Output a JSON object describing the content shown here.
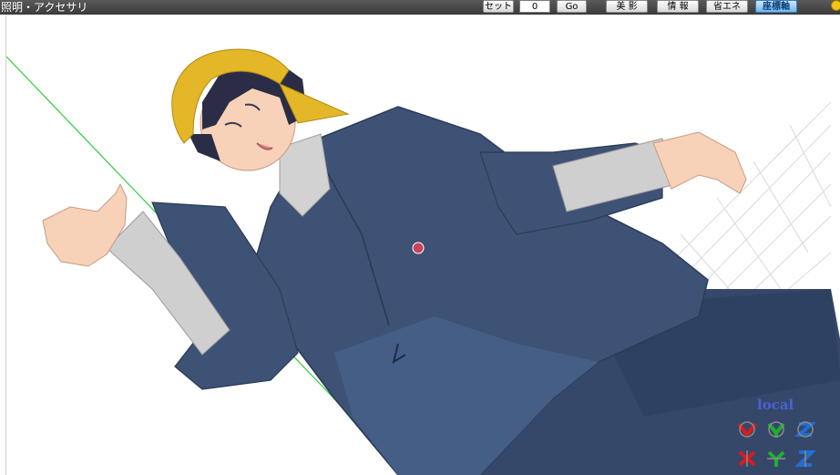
{
  "window": {
    "title": "照明・アクセサリ"
  },
  "toolbar": {
    "set_label": "セット",
    "frame_value": "0",
    "go_label": "Go",
    "beauty_label": "美 影",
    "info_label": "情 報",
    "power_save_label": "省エネ",
    "axis_label": "座標軸"
  },
  "viewport": {
    "mode": "local",
    "colors": {
      "coat": "#3e5275",
      "skin": "#f7d2b8",
      "scarf": "#e4b728",
      "hair": "#2a2d45",
      "sleeve": "#c9c9c9",
      "axis_line": "#2ecc3a",
      "axis_red": "#d91b1b",
      "axis_green": "#1fae2e",
      "axis_blue": "#1f6fd6"
    },
    "axis_icons": [
      "rotate-x-icon",
      "rotate-y-icon",
      "rotate-z-icon",
      "move-x-icon",
      "move-y-icon",
      "move-z-icon"
    ]
  }
}
